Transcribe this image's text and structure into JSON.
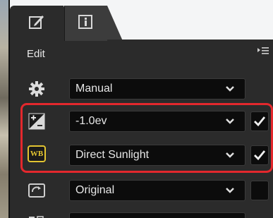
{
  "tabs": [
    {
      "name": "edit",
      "icon": "edit-pencil-icon",
      "active": true
    },
    {
      "name": "info",
      "icon": "info-icon",
      "active": false
    }
  ],
  "panel": {
    "title": "Edit",
    "menu_icon": "panel-menu-icon"
  },
  "rows": [
    {
      "icon": "gear-icon",
      "value": "Manual",
      "has_checkbox": false
    },
    {
      "icon": "exposure-compensation-icon",
      "value": "-1.0ev",
      "has_checkbox": true,
      "checked": true
    },
    {
      "icon": "white-balance-icon",
      "icon_text": "WB",
      "value": "Direct Sunlight",
      "has_checkbox": true,
      "checked": true
    },
    {
      "icon": "picture-control-icon",
      "value": "Original",
      "has_checkbox": true,
      "checked": false
    }
  ],
  "colors": {
    "highlight": "#e3282d",
    "panel": "#2b2b2b",
    "dropdown": "#0c0c0c",
    "wb_icon": "#e2c431"
  }
}
